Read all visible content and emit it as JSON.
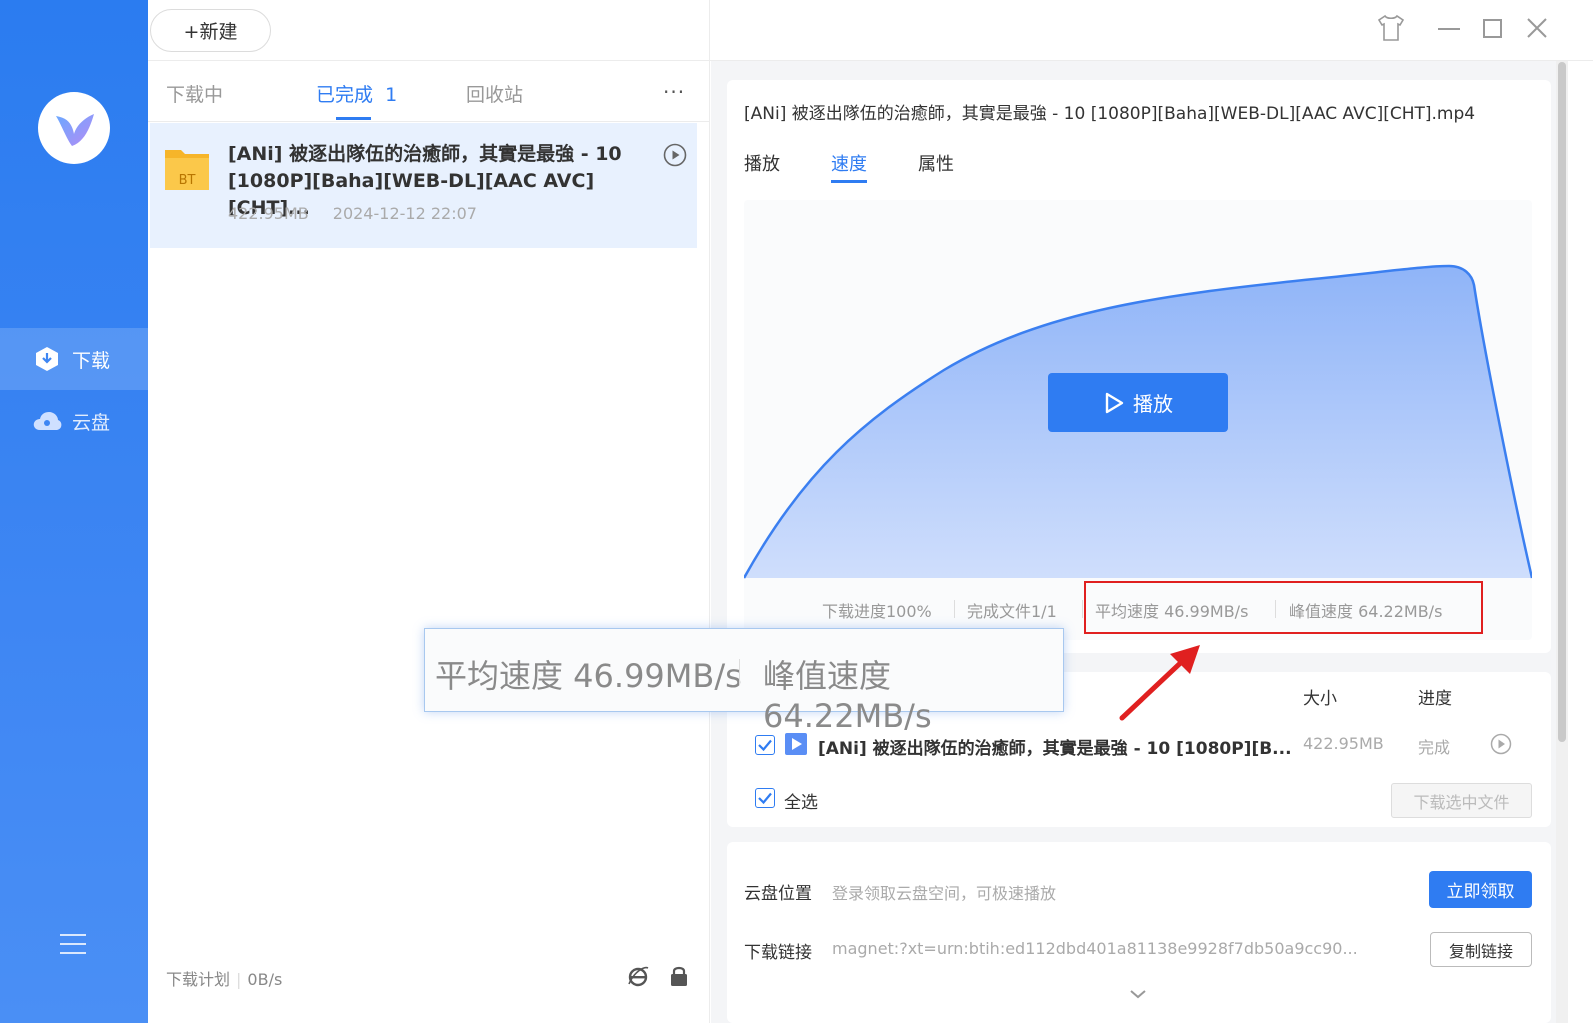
{
  "nav": {
    "items": [
      {
        "label": "下载",
        "icon": "download-shield-icon"
      },
      {
        "label": "云盘",
        "icon": "cloud-icon"
      }
    ],
    "menu_icon": "hamburger-menu-icon"
  },
  "toolbar": {
    "new_label": "+新建"
  },
  "list": {
    "tabs": [
      {
        "label": "下载中"
      },
      {
        "label": "已完成",
        "count": "1"
      },
      {
        "label": "回收站"
      }
    ],
    "more": "···",
    "item": {
      "title": "[ANi] 被逐出隊伍的治癒師，其實是最強 - 10 [1080P][Baha][WEB-DL][AAC AVC][CHT]...",
      "size": "422.95MB",
      "date": "2024-12-12 22:07",
      "type_badge": "BT"
    },
    "footer": {
      "plan": "下载计划",
      "speed": "0B/s"
    }
  },
  "detail": {
    "file_name": "[ANi] 被逐出隊伍的治癒師，其實是最強 - 10 [1080P][Baha][WEB-DL][AAC AVC][CHT].mp4",
    "tabs": [
      "播放",
      "速度",
      "属性"
    ],
    "play_label": "播放",
    "stats": {
      "progress": "下载进度100%",
      "files": "完成文件1/1",
      "avg": "平均速度 46.99MB/s",
      "peak": "峰值速度 64.22MB/s"
    },
    "files_table": {
      "col_size": "大小",
      "col_progress": "进度",
      "row": {
        "name": "[ANi] 被逐出隊伍的治癒師，其實是最強 - 10 [1080P][B...",
        "size": "422.95MB",
        "progress": "完成"
      },
      "select_all": "全选",
      "download_selected": "下载选中文件"
    },
    "cloud": {
      "label": "云盘位置",
      "value": "登录领取云盘空间，可极速播放",
      "button": "立即领取"
    },
    "link": {
      "label": "下载链接",
      "value": "magnet:?xt=urn:btih:ed112dbd401a81138e9928f7db50a9cc90...",
      "button": "复制链接"
    }
  },
  "zoom": {
    "avg": "平均速度 46.99MB/s",
    "peak": "峰值速度 64.22MB/s"
  },
  "colors": {
    "accent": "#2f7cf2",
    "nav": "#3e86f3",
    "highlight": "#e02020"
  }
}
